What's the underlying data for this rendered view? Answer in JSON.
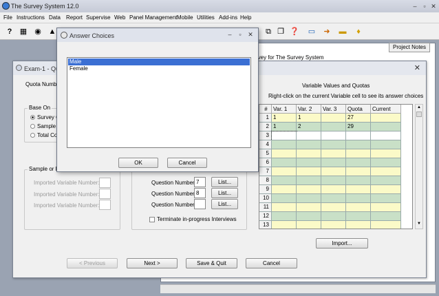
{
  "app": {
    "title": "The Survey System 12.0",
    "menu": [
      "File",
      "Instructions",
      "Data",
      "Report",
      "Supervise",
      "Web",
      "Panel Management",
      "Mobile",
      "Utilities",
      "Add-ins",
      "Help"
    ],
    "project_notes_label": "Project Notes",
    "doc_heading": "rvey for The Survey System"
  },
  "exam": {
    "title": "Exam-1 - Qu",
    "quota_number_label": "Quota Number:",
    "base_on": {
      "group_label": "Base On",
      "options": [
        "Survey Qu",
        "Sample or",
        "Total Com"
      ],
      "selected_index": 0
    },
    "sample_group_label": "Sample or Pa",
    "imported_labels": [
      "Imported Variable Number:",
      "Imported Variable Number:",
      "Imported Variable Number:"
    ],
    "questions": [
      {
        "label": "Question Number:",
        "value": "7",
        "list_label": "List..."
      },
      {
        "label": "Question Number:",
        "value": "8",
        "list_label": "List..."
      },
      {
        "label": "Question Number:",
        "value": "",
        "list_label": "List..."
      }
    ],
    "terminate_label": "Terminate in-progress Interviews",
    "grid_title": "Variable Values and Quotas",
    "grid_hint": "Right-click on the current Variable cell to see its answer choices",
    "grid_headers": [
      "#",
      "Var. 1",
      "Var. 2",
      "Var. 3",
      "Quota",
      "Current"
    ],
    "grid_rows": [
      {
        "n": "1",
        "v1": "1",
        "v2": "1",
        "v3": "",
        "quota": "27",
        "current": ""
      },
      {
        "n": "2",
        "v1": "1",
        "v2": "2",
        "v3": "",
        "quota": "29",
        "current": ""
      },
      {
        "n": "3",
        "v1": "",
        "v2": "",
        "v3": "",
        "quota": "",
        "current": ""
      },
      {
        "n": "4",
        "v1": "",
        "v2": "",
        "v3": "",
        "quota": "",
        "current": ""
      },
      {
        "n": "5",
        "v1": "",
        "v2": "",
        "v3": "",
        "quota": "",
        "current": ""
      },
      {
        "n": "6",
        "v1": "",
        "v2": "",
        "v3": "",
        "quota": "",
        "current": ""
      },
      {
        "n": "7",
        "v1": "",
        "v2": "",
        "v3": "",
        "quota": "",
        "current": ""
      },
      {
        "n": "8",
        "v1": "",
        "v2": "",
        "v3": "",
        "quota": "",
        "current": ""
      },
      {
        "n": "9",
        "v1": "",
        "v2": "",
        "v3": "",
        "quota": "",
        "current": ""
      },
      {
        "n": "10",
        "v1": "",
        "v2": "",
        "v3": "",
        "quota": "",
        "current": ""
      },
      {
        "n": "11",
        "v1": "",
        "v2": "",
        "v3": "",
        "quota": "",
        "current": ""
      },
      {
        "n": "12",
        "v1": "",
        "v2": "",
        "v3": "",
        "quota": "",
        "current": ""
      },
      {
        "n": "13",
        "v1": "",
        "v2": "",
        "v3": "",
        "quota": "",
        "current": ""
      }
    ],
    "import_label": "Import...",
    "previous_label": "< Previous",
    "next_label": "Next >",
    "save_quit_label": "Save & Quit",
    "cancel_label": "Cancel"
  },
  "answer_dialog": {
    "title": "Answer Choices",
    "choices": [
      "Male",
      "Female"
    ],
    "selected_index": 0,
    "ok_label": "OK",
    "cancel_label": "Cancel"
  },
  "colors": {
    "grid_yellow": "#fbfac8",
    "grid_green": "#c9e0c7",
    "selection_blue": "#3b6fd3"
  }
}
